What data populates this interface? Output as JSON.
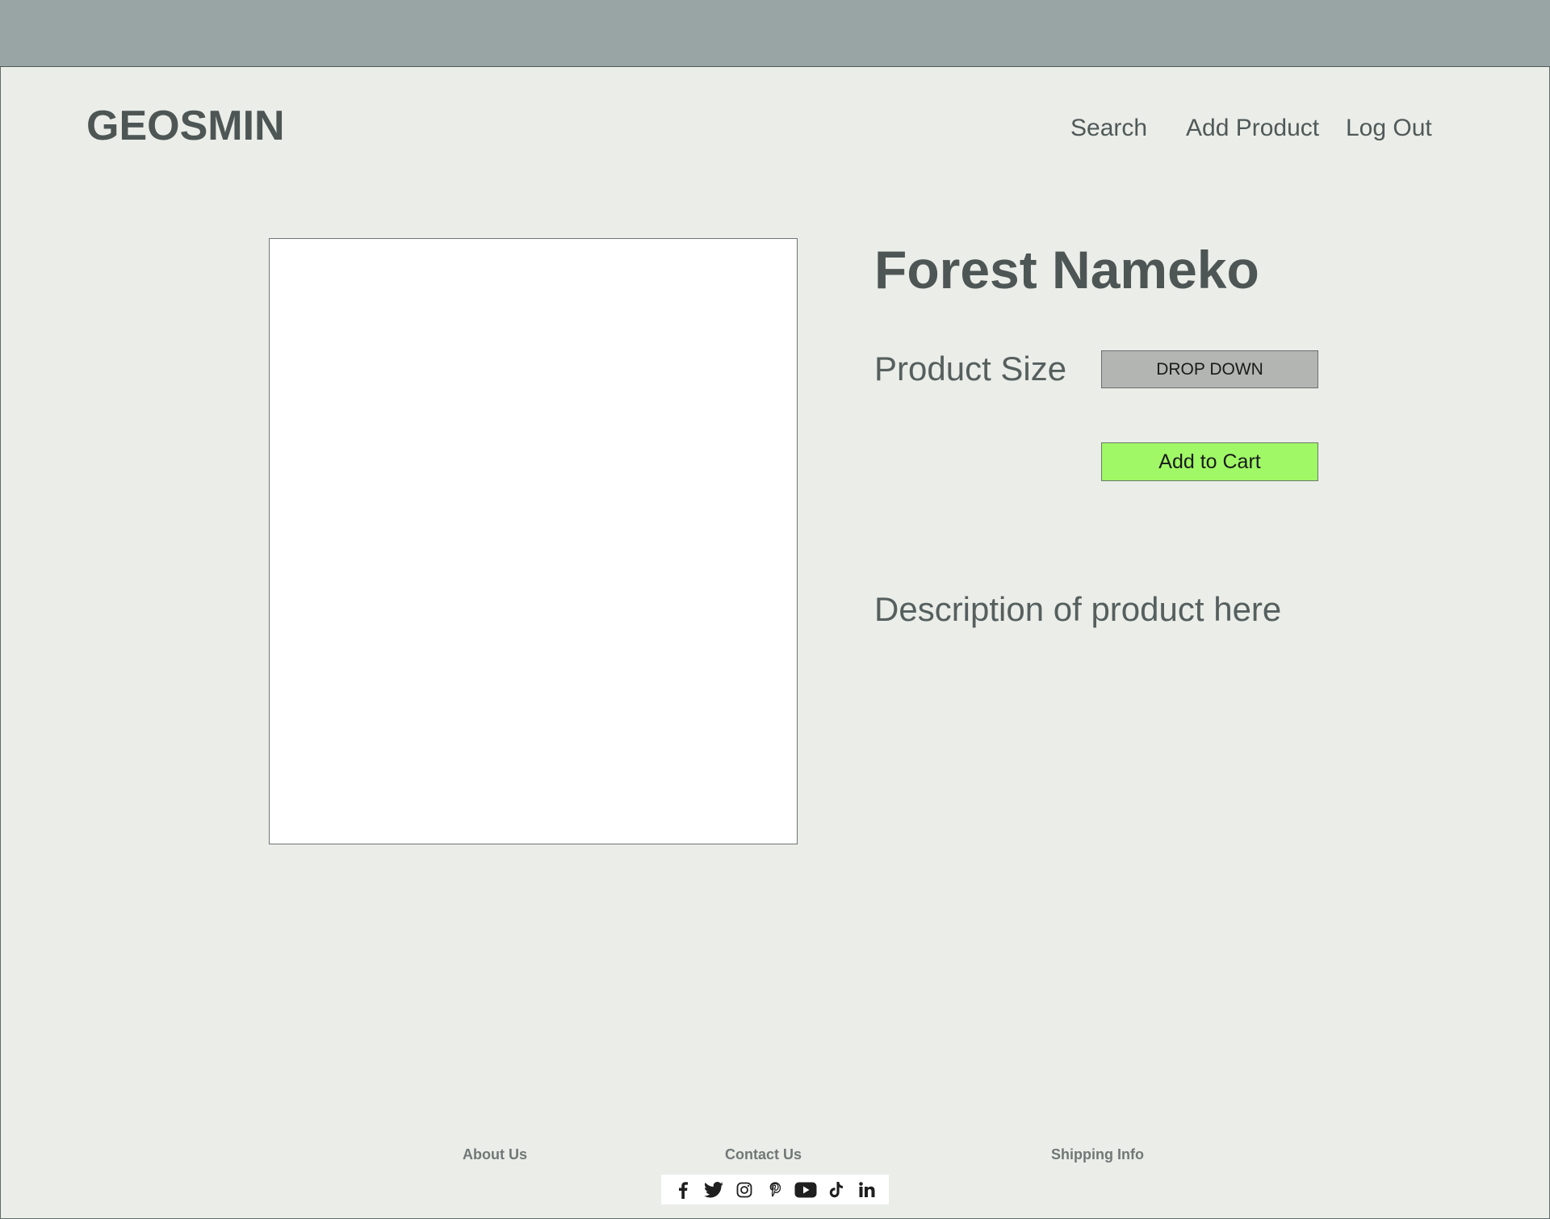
{
  "header": {
    "logo": "GEOSMIN",
    "nav": {
      "search": "Search",
      "add_product": "Add Product",
      "log_out": "Log Out"
    }
  },
  "product": {
    "title": "Forest Nameko",
    "size_label": "Product Size",
    "size_dropdown": "DROP DOWN",
    "add_to_cart": "Add to Cart",
    "description": "Description of product here"
  },
  "footer": {
    "about": "About Us",
    "contact": "Contact Us",
    "shipping": "Shipping Info",
    "social_icons": [
      "facebook-icon",
      "twitter-icon",
      "instagram-icon",
      "pinterest-icon",
      "youtube-icon",
      "tiktok-icon",
      "linkedin-icon"
    ]
  },
  "colors": {
    "topbar": "#99a5a4",
    "background": "#ebede8",
    "add_to_cart": "#a0f866",
    "dropdown": "#b3b5b3",
    "text_dark": "#4d5655"
  }
}
